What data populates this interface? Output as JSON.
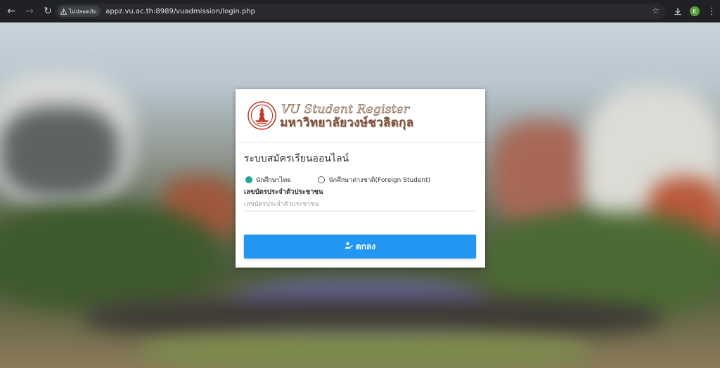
{
  "browser": {
    "security_label": "ไม่ปลอดภัย",
    "url": "appz.vu.ac.th:8989/vuadmission/login.php",
    "profile_initial": "K"
  },
  "card": {
    "brand_en": "VU Student Register",
    "brand_th": "มหาวิทยาลัยวงษ์ชวลิตกุล",
    "title": "ระบบสมัครเรียนออนไลน์",
    "radio_thai": "นักศึกษาไทย",
    "radio_foreign": "นักศึกษาต่างชาติ(Foreign Student)",
    "field_label": "เลขบัตรประจำตัวประชาชน",
    "field_placeholder": "เลขบัตรประจำตัวประชาชน",
    "submit_label": "ตกลง"
  },
  "colors": {
    "accent": "#2196f3",
    "radio_checked": "#26a69a",
    "chrome_bg": "#202124"
  }
}
